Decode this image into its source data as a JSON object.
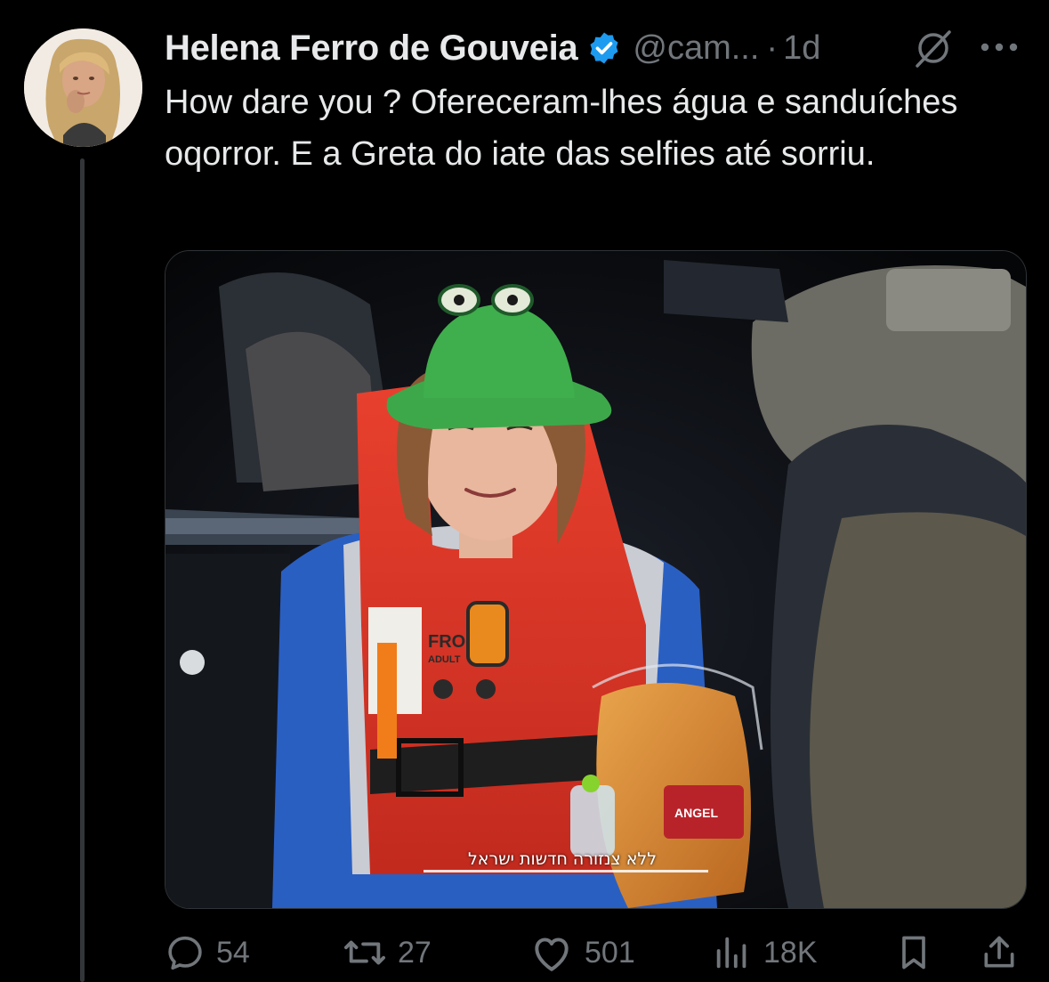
{
  "post": {
    "author": {
      "display_name": "Helena Ferro de Gouveia",
      "handle": "@cam...",
      "verified": true,
      "verified_color": "#1d9bf0"
    },
    "separator": "·",
    "time": "1d",
    "text": "How dare you ? Ofereceram-lhes água e sanduíches oqorror. E a Greta do iate das selfies até sorriu.",
    "media": {
      "overlay_caption": "ללא צנזורה חדשות ישראל",
      "vest_label": "FRO",
      "vest_sublabel": "ADULT"
    },
    "actions": {
      "replies": "54",
      "reposts": "27",
      "likes": "501",
      "views": "18K"
    },
    "icons": {
      "grok": "grok-icon",
      "more": "more-icon",
      "reply": "reply-icon",
      "repost": "repost-icon",
      "like": "heart-icon",
      "views": "views-icon",
      "bookmark": "bookmark-icon",
      "share": "share-icon"
    }
  },
  "theme": {
    "background": "#000000",
    "text": "#e7e9ea",
    "muted": "#71767b",
    "accent": "#1d9bf0"
  }
}
